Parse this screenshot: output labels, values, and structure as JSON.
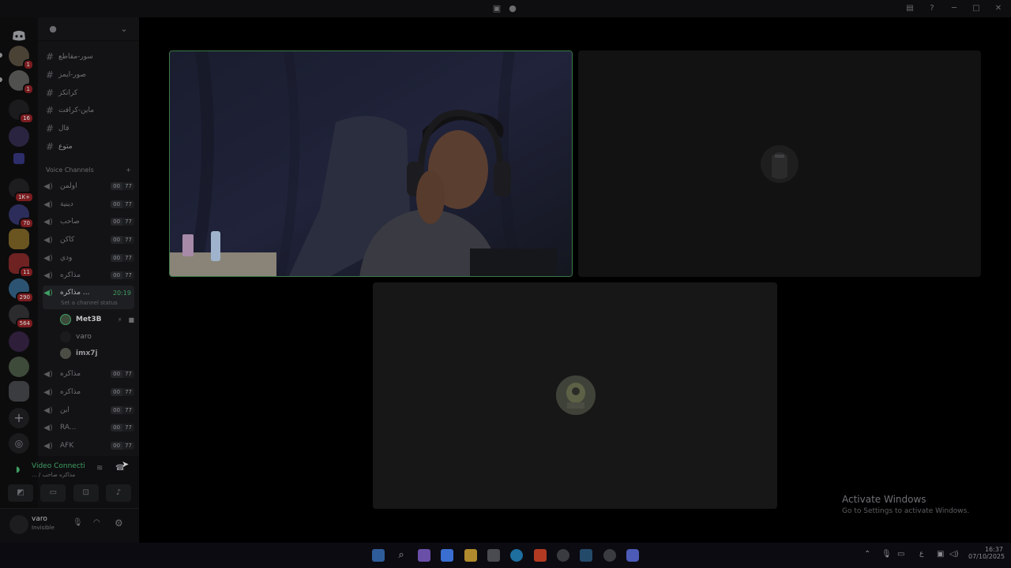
{
  "server": {
    "channels": [
      "سور-مقاطع",
      "صور-ايمز",
      "كراتكز",
      "ماين-كرافت",
      "قال",
      "متوع"
    ],
    "section_label": "Voice Channels",
    "voice_channels": [
      {
        "name": "اولمن",
        "users": "00",
        "limit": "77"
      },
      {
        "name": "دينية",
        "users": "00",
        "limit": "77"
      },
      {
        "name": "صاحب",
        "users": "00",
        "limit": "77"
      },
      {
        "name": "كاكن",
        "users": "00",
        "limit": "77"
      },
      {
        "name": "ودي",
        "users": "00",
        "limit": "77"
      },
      {
        "name": "مذاكره",
        "users": "00",
        "limit": "77"
      }
    ],
    "active_channel": {
      "name": "مذاكره ...",
      "timer": "20:19",
      "status_hint": "Set a channel status"
    },
    "members": [
      "Met3B",
      "varo",
      "imx7j"
    ],
    "voice_channels_after": [
      {
        "name": "مذاكره",
        "users": "00",
        "limit": "77"
      },
      {
        "name": "مذاكره",
        "users": "00",
        "limit": "77"
      },
      {
        "name": "اين",
        "users": "00",
        "limit": "77"
      },
      {
        "name": "RA...",
        "users": "00",
        "limit": "77"
      },
      {
        "name": "AFK",
        "users": "00",
        "limit": "77"
      }
    ]
  },
  "rail_badges": [
    "1",
    "1",
    "16",
    "1K+",
    "70",
    "11",
    "290",
    "564"
  ],
  "voice_panel": {
    "title": "Video Connecti",
    "subtitle": "... / مذاكره صاحب"
  },
  "user_panel": {
    "name": "varo",
    "status": "Invisible"
  },
  "activate_windows": {
    "title": "Activate Windows",
    "subtitle": "Go to Settings to activate Windows."
  },
  "clock": {
    "time": "16:37",
    "date": "07/10/2025"
  },
  "taskbar_lang": "ع"
}
